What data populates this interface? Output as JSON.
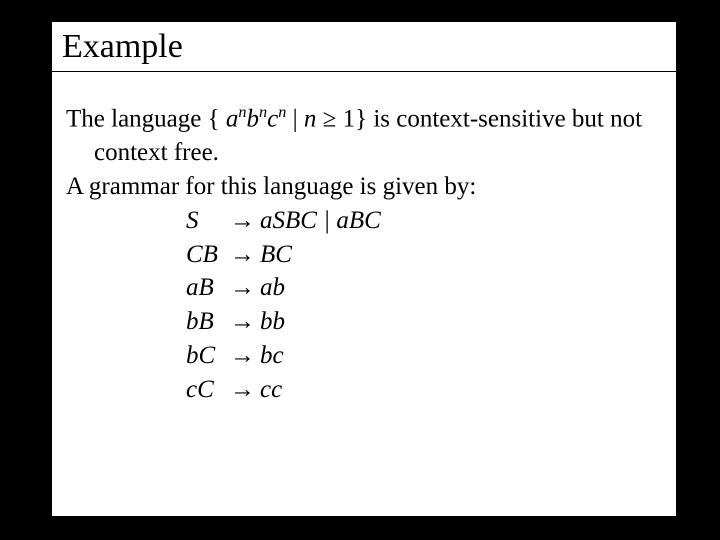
{
  "title": "Example",
  "intro": {
    "pre": "The language { ",
    "a": "a",
    "n1": "n",
    "b": "b",
    "n2": "n",
    "c": "c",
    "n3": "n",
    "mid1": " | ",
    "nvar": "n",
    "ge": " ≥ 1} ",
    "post": "is context-sensitive but not context free."
  },
  "line2": "A grammar for this language is given by:",
  "arrow": "→",
  "rules": [
    {
      "lhs": "S",
      "rhs": "aSBC | aBC"
    },
    {
      "lhs": "CB",
      "rhs": "BC"
    },
    {
      "lhs": "aB",
      "rhs": "ab"
    },
    {
      "lhs": "bB",
      "rhs": "bb"
    },
    {
      "lhs": "bC",
      "rhs": "bc"
    },
    {
      "lhs": "cC",
      "rhs": "cc"
    }
  ]
}
